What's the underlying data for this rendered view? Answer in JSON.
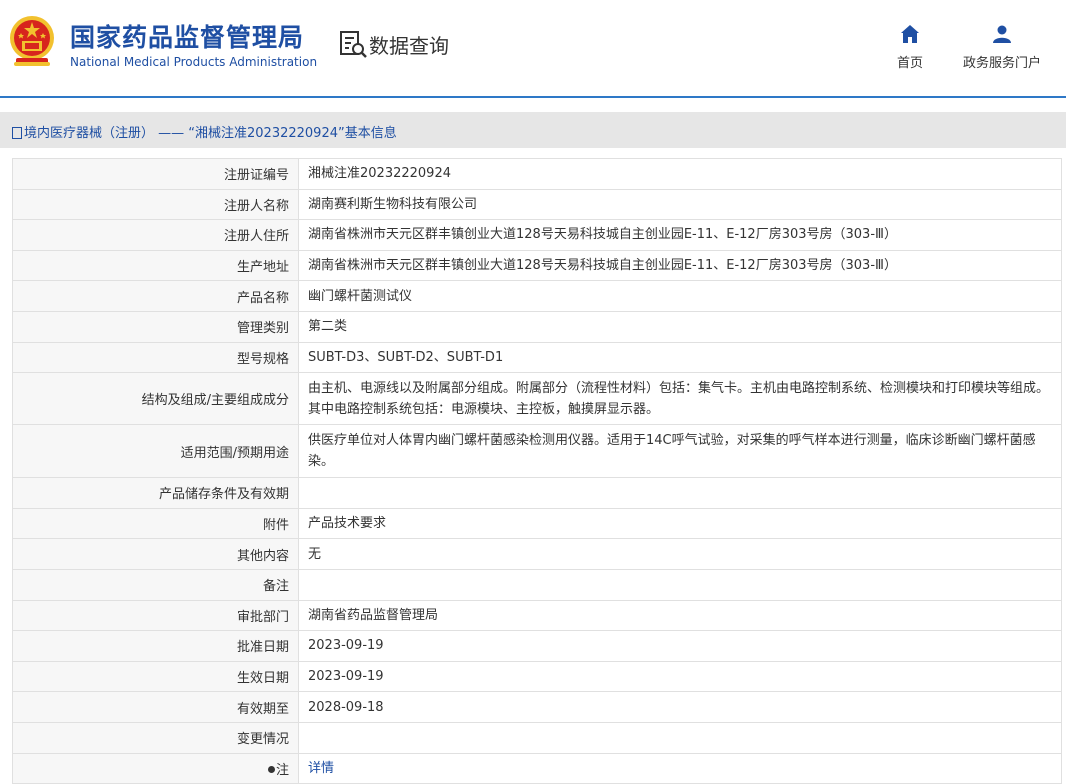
{
  "header": {
    "agency_cn": "国家药品监督管理局",
    "agency_en": "National Medical Products Administration",
    "query_label": "数据查询",
    "nav": [
      {
        "label": "首页",
        "icon": "home-icon"
      },
      {
        "label": "政务服务门户",
        "icon": "user-icon"
      }
    ]
  },
  "colors": {
    "brand_blue": "#1f4fa3",
    "emblem_red": "#d7251d",
    "emblem_gold": "#f2c12e"
  },
  "breadcrumb": "境内医疗器械（注册） —— “湘械注准20232220924”基本信息",
  "rows": [
    {
      "label": "注册证编号",
      "value": "湘械注准20232220924"
    },
    {
      "label": "注册人名称",
      "value": "湖南赛利斯生物科技有限公司"
    },
    {
      "label": "注册人住所",
      "value": "湖南省株洲市天元区群丰镇创业大道128号天易科技城自主创业园E-11、E-12厂房303号房（303-Ⅲ）"
    },
    {
      "label": "生产地址",
      "value": "湖南省株洲市天元区群丰镇创业大道128号天易科技城自主创业园E-11、E-12厂房303号房（303-Ⅲ）"
    },
    {
      "label": "产品名称",
      "value": "幽门螺杆菌测试仪"
    },
    {
      "label": "管理类别",
      "value": "第二类"
    },
    {
      "label": "型号规格",
      "value": "SUBT-D3、SUBT-D2、SUBT-D1"
    },
    {
      "label": "结构及组成/主要组成成分",
      "value": "由主机、电源线以及附属部分组成。附属部分（流程性材料）包括：集气卡。主机由电路控制系统、检测模块和打印模块等组成。其中电路控制系统包括：电源模块、主控板，触摸屏显示器。"
    },
    {
      "label": "适用范围/预期用途",
      "value": "供医疗单位对人体胃内幽门螺杆菌感染检测用仪器。适用于14C呼气试验，对采集的呼气样本进行测量，临床诊断幽门螺杆菌感染。"
    },
    {
      "label": "产品储存条件及有效期",
      "value": ""
    },
    {
      "label": "附件",
      "value": "产品技术要求"
    },
    {
      "label": "其他内容",
      "value": "无"
    },
    {
      "label": "备注",
      "value": ""
    },
    {
      "label": "审批部门",
      "value": "湖南省药品监督管理局"
    },
    {
      "label": "批准日期",
      "value": "2023-09-19"
    },
    {
      "label": "生效日期",
      "value": "2023-09-19"
    },
    {
      "label": "有效期至",
      "value": "2028-09-18"
    },
    {
      "label": "变更情况",
      "value": ""
    },
    {
      "label": "注",
      "value": "详情"
    }
  ]
}
